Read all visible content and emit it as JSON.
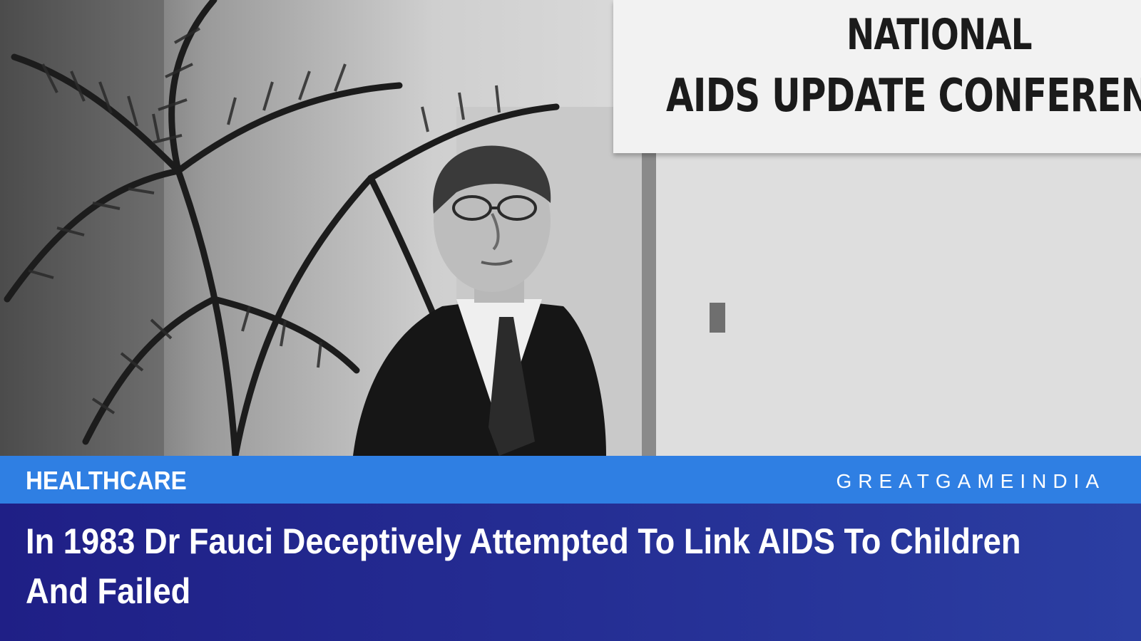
{
  "photo": {
    "banner": {
      "line1": "NATIONAL",
      "line2": "AIDS UPDATE CONFEREN"
    }
  },
  "category": "HEALTHCARE",
  "brand": "GREATGAMEINDIA",
  "headline": "In 1983 Dr Fauci Deceptively Attempted To Link AIDS To Children And Failed",
  "colors": {
    "category_bar": "#2f7fe3",
    "headline_bar": "#242c92",
    "text": "#ffffff"
  }
}
